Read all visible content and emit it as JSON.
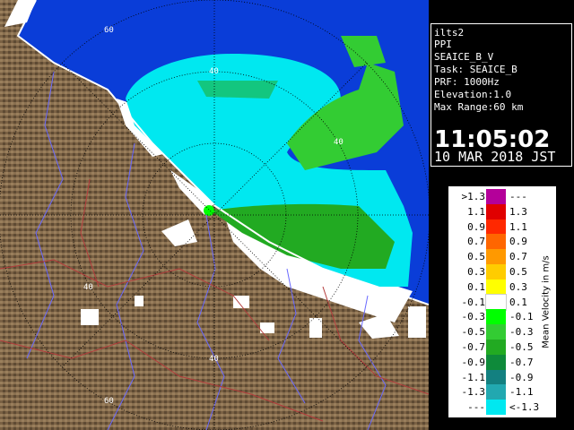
{
  "info": {
    "station": "ilts2",
    "mode": "PPI",
    "product": "SEAICE_B_V",
    "task": "Task: SEAICE_B",
    "prf": "PRF: 1000Hz",
    "elevation": "Elevation:1.0",
    "max_range": "Max Range:60 km",
    "time": "11:05:02",
    "date": "10 MAR 2018 JST"
  },
  "map": {
    "range_labels": [
      "60",
      "40",
      "40",
      "40",
      "40",
      "60"
    ]
  },
  "legend": {
    "title": "Mean Velocity in m/s",
    "rows": [
      {
        "lo": ">1.3",
        "hi": "---",
        "color": "#b4009a"
      },
      {
        "lo": "1.1",
        "hi": "1.3",
        "color": "#e00000"
      },
      {
        "lo": "0.9",
        "hi": "1.1",
        "color": "#ff2800"
      },
      {
        "lo": "0.7",
        "hi": "0.9",
        "color": "#ff6600"
      },
      {
        "lo": "0.5",
        "hi": "0.7",
        "color": "#ff9900"
      },
      {
        "lo": "0.3",
        "hi": "0.5",
        "color": "#ffcc00"
      },
      {
        "lo": "0.1",
        "hi": "0.3",
        "color": "#ffff00"
      },
      {
        "lo": "-0.1",
        "hi": "0.1",
        "color": "#ffffff"
      },
      {
        "lo": "-0.3",
        "hi": "-0.1",
        "color": "#00ff00"
      },
      {
        "lo": "-0.5",
        "hi": "-0.3",
        "color": "#33cc33"
      },
      {
        "lo": "-0.7",
        "hi": "-0.5",
        "color": "#22aa22"
      },
      {
        "lo": "-0.9",
        "hi": "-0.7",
        "color": "#0e8a3a"
      },
      {
        "lo": "-1.1",
        "hi": "-0.9",
        "color": "#138080"
      },
      {
        "lo": "-1.3",
        "hi": "-1.1",
        "color": "#22a8b0"
      },
      {
        "lo": "---",
        "hi": "<-1.3",
        "color": "#00e8f0"
      }
    ],
    "colors": {
      "sea": "#0a3dd8",
      "land": "#7a6144",
      "rivers": "#6a6aff",
      "boundaries": "#b43c3c"
    }
  }
}
